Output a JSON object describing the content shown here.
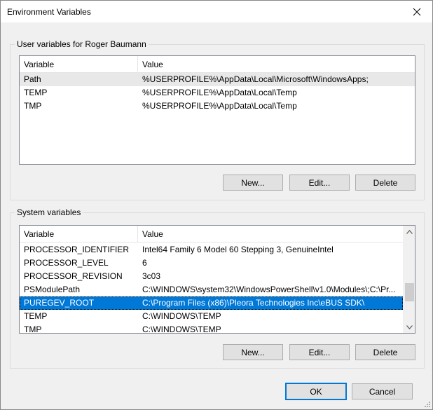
{
  "window": {
    "title": "Environment Variables",
    "close_icon": "close-icon"
  },
  "user_group": {
    "title": "User variables for Roger Baumann",
    "columns": [
      "Variable",
      "Value"
    ],
    "rows": [
      {
        "variable": "Path",
        "value": "%USERPROFILE%\\AppData\\Local\\Microsoft\\WindowsApps;"
      },
      {
        "variable": "TEMP",
        "value": "%USERPROFILE%\\AppData\\Local\\Temp"
      },
      {
        "variable": "TMP",
        "value": "%USERPROFILE%\\AppData\\Local\\Temp"
      }
    ],
    "buttons": {
      "new": "New...",
      "edit": "Edit...",
      "delete": "Delete"
    }
  },
  "system_group": {
    "title": "System variables",
    "columns": [
      "Variable",
      "Value"
    ],
    "rows": [
      {
        "variable": "PROCESSOR_IDENTIFIER",
        "value": "Intel64 Family 6 Model 60 Stepping 3, GenuineIntel"
      },
      {
        "variable": "PROCESSOR_LEVEL",
        "value": "6"
      },
      {
        "variable": "PROCESSOR_REVISION",
        "value": "3c03"
      },
      {
        "variable": "PSModulePath",
        "value": "C:\\WINDOWS\\system32\\WindowsPowerShell\\v1.0\\Modules\\;C:\\Pr..."
      },
      {
        "variable": "PUREGEV_ROOT",
        "value": "C:\\Program Files (x86)\\Pleora Technologies Inc\\eBUS SDK\\"
      },
      {
        "variable": "TEMP",
        "value": "C:\\WINDOWS\\TEMP"
      },
      {
        "variable": "TMP",
        "value": "C:\\WINDOWS\\TEMP"
      }
    ],
    "selected_variable": "PUREGEV_ROOT",
    "buttons": {
      "new": "New...",
      "edit": "Edit...",
      "delete": "Delete"
    }
  },
  "footer": {
    "ok": "OK",
    "cancel": "Cancel"
  },
  "colors": {
    "selection": "#0078d7",
    "default_button_border": "#0078d7"
  }
}
